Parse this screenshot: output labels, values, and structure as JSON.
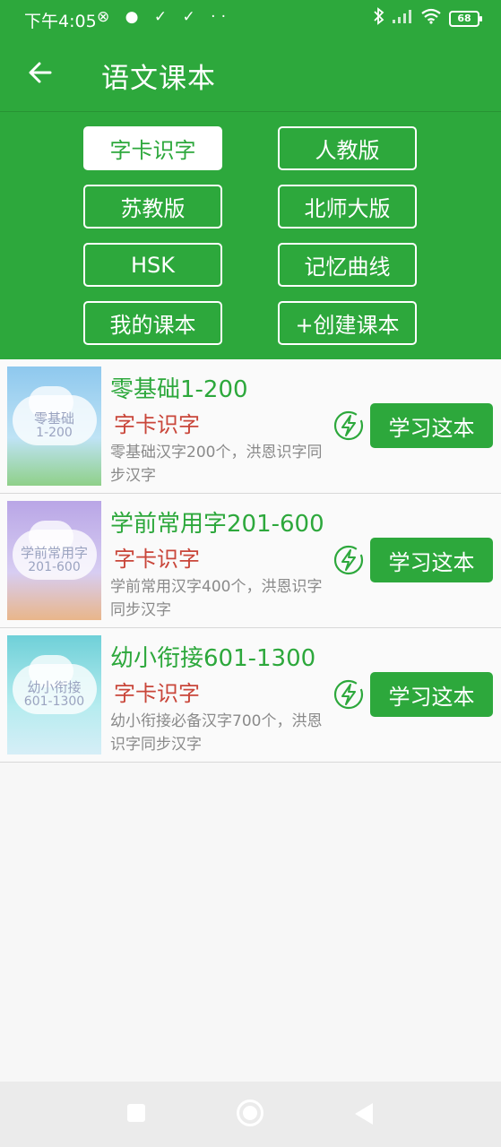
{
  "status_bar": {
    "time": "下午4:05",
    "left_icons": [
      "mute-bell-icon",
      "chat-icon",
      "checkmark-icon",
      "checkmark-icon",
      "more-icon"
    ],
    "left_icon_text": "⊗ ● ✓ ✓ ··",
    "right_icons": [
      "bluetooth-icon",
      "signal-icon",
      "wifi-icon",
      "battery-icon"
    ],
    "battery": "68"
  },
  "app_bar": {
    "title": "语文课本"
  },
  "tags": [
    {
      "label": "字卡识字",
      "active": true
    },
    {
      "label": "人教版",
      "active": false
    },
    {
      "label": "苏教版",
      "active": false
    },
    {
      "label": "北师大版",
      "active": false
    },
    {
      "label": "HSK",
      "active": false
    },
    {
      "label": "记忆曲线",
      "active": false
    },
    {
      "label": "我的课本",
      "active": false
    },
    {
      "label": "+创建课本",
      "active": false
    }
  ],
  "books": [
    {
      "title": "零基础1-200",
      "tag": "字卡识字",
      "description": "零基础汉字200个，洪恩识字同步汉字",
      "cover_line1": "零基础",
      "cover_line2": "1-200",
      "button": "学习这本"
    },
    {
      "title": "学前常用字201-600",
      "tag": "字卡识字",
      "description": "学前常用汉字400个，洪恩识字同步汉字",
      "cover_line1": "学前常用字",
      "cover_line2": "201-600",
      "button": "学习这本"
    },
    {
      "title": "幼小衔接601-1300",
      "tag": "字卡识字",
      "description": "幼小衔接必备汉字700个，洪恩识字同步汉字",
      "cover_line1": "幼小衔接",
      "cover_line2": "601-1300",
      "button": "学习这本"
    }
  ],
  "colors": {
    "primary": "#2da83c",
    "tag_red": "#c9463a",
    "description_gray": "#8a8a8a",
    "background": "#f7f7f7",
    "nav_bar": "#ebebeb",
    "cover1_sky": "#8ec8ee",
    "cover2_sky": "#b9a6e6",
    "cover3_sky": "#6fd0d8"
  }
}
